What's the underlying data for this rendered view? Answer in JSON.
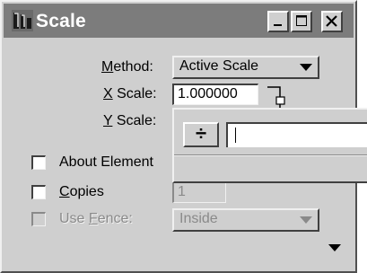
{
  "window": {
    "title": "Scale",
    "controls": {
      "minimize": "_",
      "maximize": "□",
      "close": "×"
    }
  },
  "method": {
    "label": "Method:",
    "value": "Active Scale"
  },
  "x_scale": {
    "label": "X Scale:",
    "value": "1.000000"
  },
  "y_scale": {
    "label": "Y Scale:"
  },
  "about_element": {
    "label": "About Element",
    "checked": false
  },
  "copies": {
    "label": "Copies",
    "value": "1",
    "checked": false
  },
  "use_fence": {
    "label": "Use Fence:",
    "value": "Inside",
    "checked": false,
    "enabled": false
  },
  "calculator": {
    "operator": "÷",
    "input_value": ""
  },
  "icons": {
    "app": "microstation-scale-icon",
    "lock": "lock-icon",
    "dropdown": "chevron-down-icon",
    "expand": "expand-arrow-icon"
  }
}
